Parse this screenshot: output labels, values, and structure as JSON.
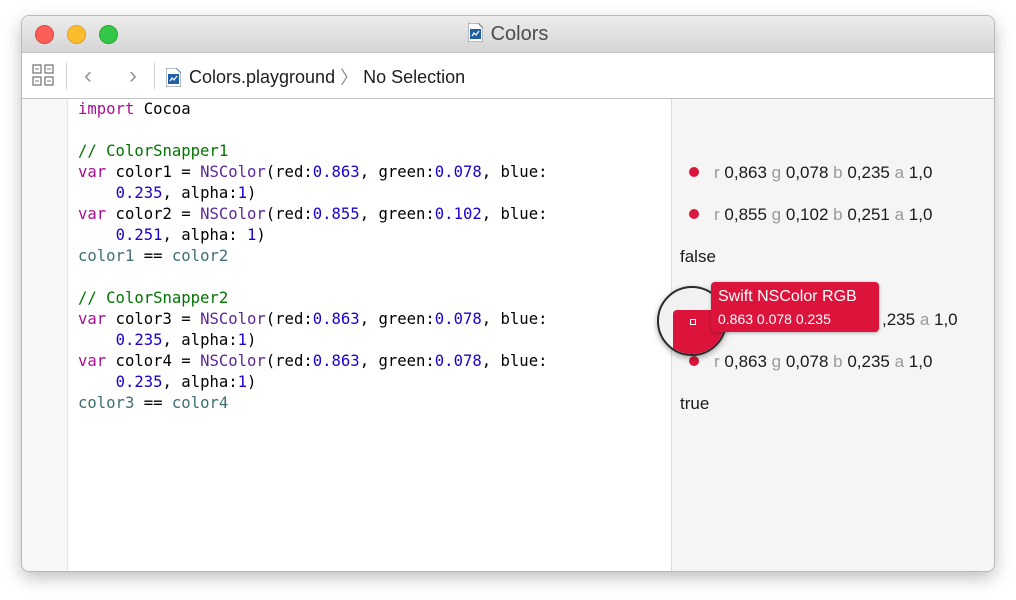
{
  "window": {
    "title": "Colors"
  },
  "toolbar": {
    "file_name": "Colors.playground",
    "chevron": "〉",
    "selection": "No Selection",
    "back_glyph": "‹",
    "forward_glyph": "›"
  },
  "code": {
    "l1_kw": "import",
    "l1_rest": " Cocoa",
    "l3": "// ColorSnapper1",
    "l4": {
      "a": "var",
      "b": " color1 = ",
      "c": "NSColor",
      "d": "(red:",
      "e": "0.863",
      "f": ", green:",
      "g": "0.078",
      "h": ", blue:"
    },
    "l5": {
      "a": "    ",
      "b": "0.235",
      "c": ", alpha:",
      "d": "1",
      "e": ")"
    },
    "l6": {
      "a": "var",
      "b": " color2 = ",
      "c": "NSColor",
      "d": "(red:",
      "e": "0.855",
      "f": ", green:",
      "g": "0.102",
      "h": ", blue:"
    },
    "l7": {
      "a": "    ",
      "b": "0.251",
      "c": ", alpha: ",
      "d": "1",
      "e": ")"
    },
    "l8": {
      "a": "color1",
      "b": " == ",
      "c": "color2"
    },
    "l10": "// ColorSnapper2",
    "l11": {
      "a": "var",
      "b": " color3 = ",
      "c": "NSColor",
      "d": "(red:",
      "e": "0.863",
      "f": ", green:",
      "g": "0.078",
      "h": ", blue:"
    },
    "l12": {
      "a": "    ",
      "b": "0.235",
      "c": ", alpha:",
      "d": "1",
      "e": ")"
    },
    "l13": {
      "a": "var",
      "b": " color4 = ",
      "c": "NSColor",
      "d": "(red:",
      "e": "0.863",
      "f": ", green:",
      "g": "0.078",
      "h": ", blue:"
    },
    "l14": {
      "a": "    ",
      "b": "0.235",
      "c": ", alpha:",
      "d": "1",
      "e": ")"
    },
    "l15": {
      "a": "color3",
      "b": " == ",
      "c": "color4"
    }
  },
  "results": {
    "r1": {
      "r": "r",
      "rv": " 0,863 ",
      "g": "g",
      "gv": " 0,078 ",
      "b": "b",
      "bv": " 0,235 ",
      "a": "a",
      "av": " 1,0"
    },
    "r2": {
      "r": "r",
      "rv": " 0,855 ",
      "g": "g",
      "gv": " 0,102 ",
      "b": "b",
      "bv": " 0,251 ",
      "a": "a",
      "av": " 1,0"
    },
    "r3": "false",
    "r4": {
      "bv": ",235 ",
      "a": "a",
      "av": " 1,0"
    },
    "r5": {
      "r": "r",
      "rv": " 0,863 ",
      "g": "g",
      "gv": " 0,078 ",
      "b": "b",
      "bv": " 0,235 ",
      "a": "a",
      "av": " 1,0"
    },
    "r6": "true"
  },
  "tooltip": {
    "title": "Swift NSColor RGB",
    "values": "0.863 0.078 0.235"
  },
  "colors": {
    "swatch": "#dc143c",
    "keyword": "#aa0d91",
    "class": "#5c2699",
    "number": "#1c00cf",
    "comment": "#007400"
  },
  "icons": {
    "doc": "playground-file-icon",
    "grid": "related-items-icon"
  }
}
